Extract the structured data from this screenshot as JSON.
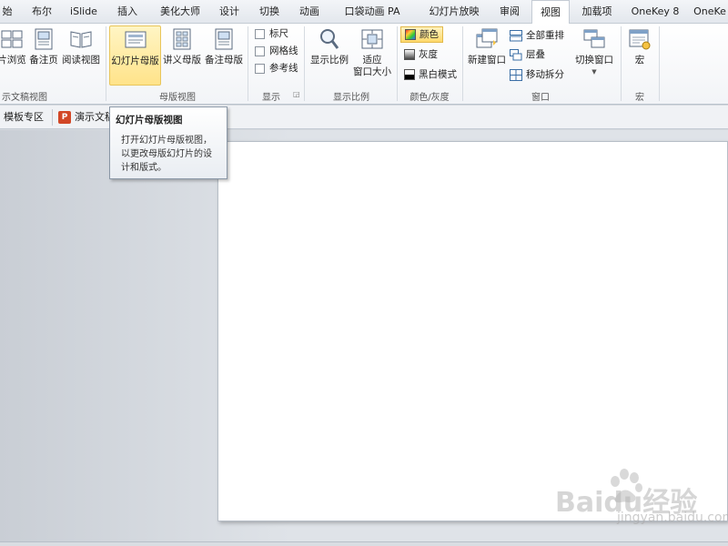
{
  "tabs": [
    {
      "label": "始"
    },
    {
      "label": "布尔"
    },
    {
      "label": "iSlide"
    },
    {
      "label": "插入"
    },
    {
      "label": "美化大师"
    },
    {
      "label": "设计"
    },
    {
      "label": "切换"
    },
    {
      "label": "动画"
    },
    {
      "label": "口袋动画 PA"
    },
    {
      "label": "幻灯片放映"
    },
    {
      "label": "审阅"
    },
    {
      "label": "视图"
    },
    {
      "label": "加载项"
    },
    {
      "label": "OneKey 8"
    },
    {
      "label": "OneKe"
    }
  ],
  "ribbon": {
    "pres_views": {
      "label": "示文稿视图",
      "slide_sorter": "片浏览",
      "notes_page": "备注页",
      "reading_view": "阅读视图"
    },
    "master_views": {
      "label": "母版视图",
      "slide_master": "幻灯片母版",
      "handout_master": "讲义母版",
      "notes_master": "备注母版"
    },
    "show": {
      "label": "显示",
      "ruler": "标尺",
      "gridlines": "网格线",
      "guides": "参考线"
    },
    "zoom": {
      "label": "显示比例",
      "zoom": "显示比例",
      "fit_window_1": "适应",
      "fit_window_2": "窗口大小"
    },
    "color": {
      "label": "颜色/灰度",
      "color": "颜色",
      "grayscale": "灰度",
      "black_white": "黑白模式"
    },
    "window": {
      "label": "窗口",
      "new_window": "新建窗口",
      "arrange_all": "全部重排",
      "cascade": "层叠",
      "move_split": "移动拆分",
      "switch_window": "切换窗口"
    },
    "macros": {
      "label": "宏",
      "macros": "宏"
    }
  },
  "docbar": {
    "template_zone": "模板专区",
    "presentation": "演示文稿"
  },
  "tooltip": {
    "title": "幻灯片母版视图",
    "body_1": "打开幻灯片母版视图，",
    "body_2": "以更改母版幻灯片的设",
    "body_3": "计和版式。"
  },
  "watermark": {
    "brand": "Baidu经验",
    "url": "jingyan.baidu.com"
  },
  "colors": {
    "accent_tab": "#ffffff",
    "highlight": "#ffe38a",
    "ppt_icon": "#d24726"
  }
}
